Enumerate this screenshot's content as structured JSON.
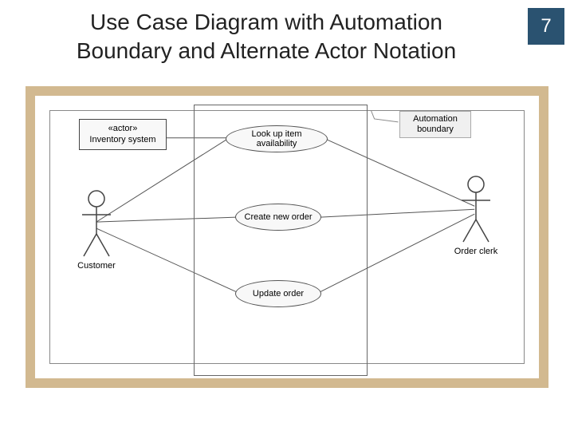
{
  "title_line1": "Use Case Diagram with Automation",
  "title_line2": "Boundary and Alternate Actor Notation",
  "page_number": "7",
  "actor_box": {
    "stereotype": "«actor»",
    "name": "Inventory system"
  },
  "actors": {
    "customer": "Customer",
    "order_clerk": "Order clerk"
  },
  "usecases": {
    "uc1": "Look up item availability",
    "uc2": "Create new order",
    "uc3": "Update order"
  },
  "callout": {
    "line1": "Automation",
    "line2": "boundary"
  },
  "colors": {
    "badge_bg": "#2a5270",
    "frame_border": "#d2b990"
  }
}
